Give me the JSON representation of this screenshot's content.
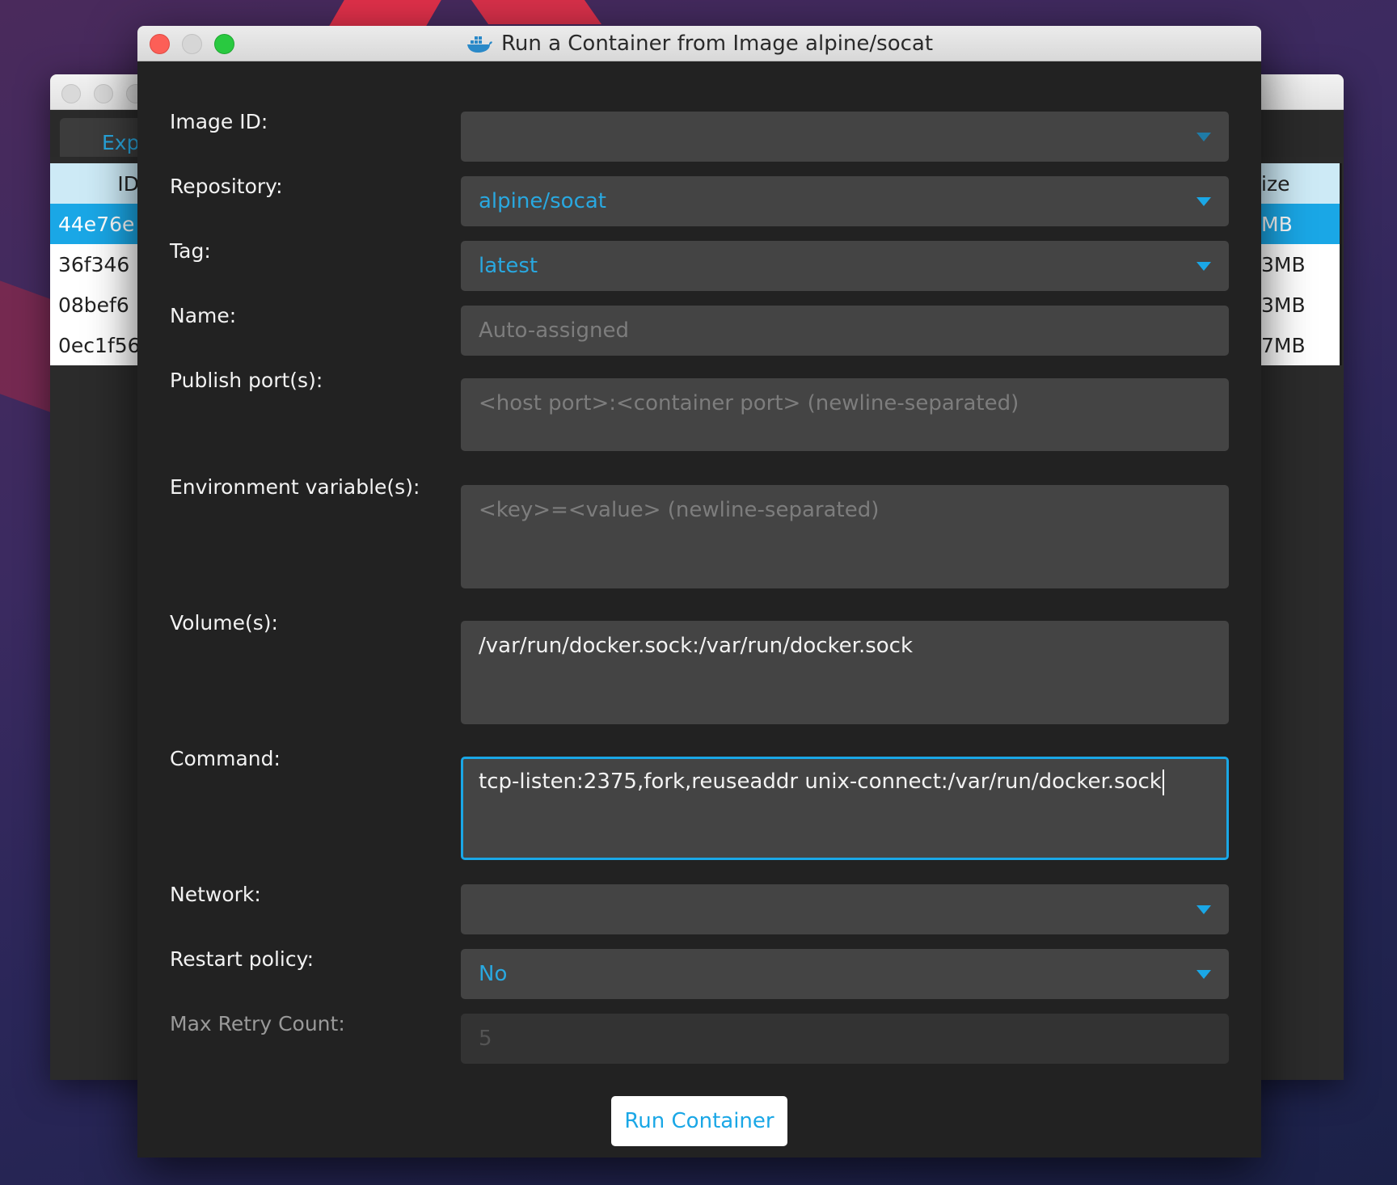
{
  "dialog": {
    "title": "Run a Container from Image alpine/socat",
    "run_button_label": "Run Container"
  },
  "background_window": {
    "tab_label": "Exp",
    "left_header": "ID",
    "right_header": "ize",
    "ids": [
      "44e76e",
      "36f346",
      "08bef6",
      "0ec1f56"
    ],
    "sizes": [
      "MB",
      "3MB",
      "3MB",
      "7MB"
    ]
  },
  "form": {
    "image_id": {
      "label": "Image ID:",
      "value": ""
    },
    "repository": {
      "label": "Repository:",
      "value": "alpine/socat"
    },
    "tag": {
      "label": "Tag:",
      "value": "latest"
    },
    "name": {
      "label": "Name:",
      "placeholder": "Auto-assigned"
    },
    "ports": {
      "label": "Publish port(s):",
      "placeholder": "<host port>:<container port> (newline-separated)"
    },
    "env": {
      "label": "Environment variable(s):",
      "placeholder": "<key>=<value> (newline-separated)"
    },
    "volumes": {
      "label": "Volume(s):",
      "value": "/var/run/docker.sock:/var/run/docker.sock"
    },
    "command": {
      "label": "Command:",
      "value": "tcp-listen:2375,fork,reuseaddr unix-connect:/var/run/docker.sock"
    },
    "network": {
      "label": "Network:",
      "value": ""
    },
    "restart_policy": {
      "label": "Restart policy:",
      "value": "No"
    },
    "max_retry": {
      "label": "Max Retry Count:",
      "placeholder": "5"
    }
  },
  "colors": {
    "accent": "#1aa7e6",
    "dialog_bg": "#222222",
    "field_bg": "#444444",
    "close": "#fc5f57",
    "maximize": "#29c940"
  },
  "icons": {
    "title": "docker-whale-icon",
    "dropdown": "chevron-down-icon"
  }
}
